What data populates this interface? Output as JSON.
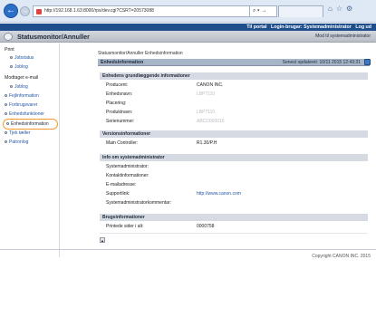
{
  "browser": {
    "url": "http://192.168.1.63:8000/rps/dev.cgi?CSRT=20573088",
    "addr_tools": "⌕ ▾ →"
  },
  "header": {
    "top_links": [
      "Til portal",
      "Login-brugar: Systemadministrator",
      "Log ud"
    ],
    "app_title": "Statusmonitor/Annuller",
    "to_sysmgr": "Mod til systemadministrator"
  },
  "sidebar": {
    "print_heading": "Print",
    "print_items": [
      "Jobstatus",
      "Joblog"
    ],
    "email_heading": "Modtaget e-mail",
    "email_items": [
      "Joblog"
    ],
    "items": [
      "Fejlinformation",
      "Forbrugsvarer",
      "Enhedsfunktioner",
      "Enhedsinformation",
      "Tjek tæller",
      "Patronlog"
    ],
    "selected_index": 3
  },
  "main": {
    "breadcrumb": "Statusmonitor/Annuller  Enhedsinformation",
    "page_title": "Enhedsinformation",
    "last_updated": "Senest opdateret: 10/11 2015 12:43:31",
    "sections": [
      {
        "title": "Enhedens grundlæggende informationer",
        "rows": [
          {
            "label": "Producent:",
            "value": "CANON INC."
          },
          {
            "label": "Enhedsnavn:",
            "value": "LBP7110",
            "blurred": true
          },
          {
            "label": "Placering:",
            "value": ""
          },
          {
            "label": "Produktnavn:",
            "value": "LBP7110",
            "blurred": true
          },
          {
            "label": "Serienummer:",
            "value": "ABCD000015",
            "blurred": true
          }
        ]
      },
      {
        "title": "Versionsinformationer",
        "rows": [
          {
            "label": "Main Controller:",
            "value": "R1.30/P.H"
          }
        ]
      },
      {
        "title": "Info om systemadministrator",
        "rows": [
          {
            "label": "Systemadministrator:",
            "value": ""
          },
          {
            "label": "Kontaktinformationer:",
            "value": ""
          },
          {
            "label": "E-mailadresse:",
            "value": ""
          },
          {
            "label": "Supportlink:",
            "value": "http://www.canon.com",
            "link": true
          },
          {
            "label": "Systemadministratorkommentar:",
            "value": ""
          }
        ]
      },
      {
        "title": "Brugsinformationer",
        "rows": [
          {
            "label": "Printede sider i alt:",
            "value": "0000758"
          }
        ]
      }
    ]
  },
  "footer": {
    "top_button": "▲",
    "copyright": "Copyright CANON INC. 2015"
  }
}
